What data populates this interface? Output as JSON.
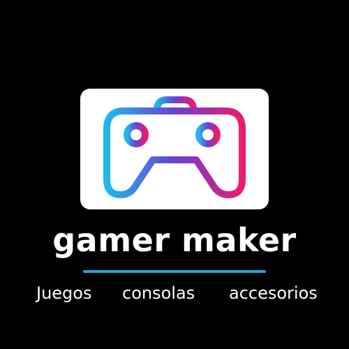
{
  "brand": {
    "name": "gamer maker",
    "icon": "gamepad-icon",
    "colors": {
      "background": "#000000",
      "card": "#ffffff",
      "text": "#ffffff",
      "divider": "#1fa6d8",
      "gradient_start": "#1fb8e8",
      "gradient_mid": "#6a3fd6",
      "gradient_end": "#ec1c6c"
    }
  },
  "categories": [
    "Juegos",
    "consolas",
    "accesorios"
  ]
}
